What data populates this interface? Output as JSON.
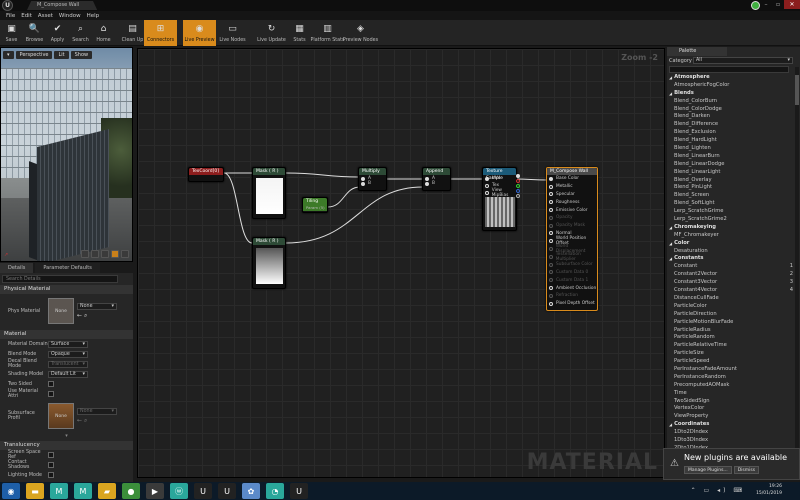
{
  "window": {
    "title": "M_Compose Wall",
    "tab_label": "M_Compose Wall",
    "logo": "U"
  },
  "menu": [
    "File",
    "Edit",
    "Asset",
    "Window",
    "Help"
  ],
  "toolbar": [
    {
      "id": "save",
      "label": "Save",
      "icon": "save-icon",
      "glyph": "▣"
    },
    {
      "id": "browse",
      "label": "Browse",
      "icon": "browse-icon",
      "glyph": "🔍"
    },
    {
      "id": "apply",
      "label": "Apply",
      "icon": "apply-icon",
      "glyph": "✔"
    },
    {
      "id": "search",
      "label": "Search",
      "icon": "search-icon",
      "glyph": "⌕"
    },
    {
      "id": "home",
      "label": "Home",
      "icon": "home-icon",
      "glyph": "⌂"
    },
    {
      "id": "cleanup",
      "label": "Clean Up",
      "icon": "cleanup-icon",
      "glyph": "▤"
    },
    {
      "id": "connectors",
      "label": "Connectors",
      "icon": "connectors-icon",
      "glyph": "⊞",
      "active": true
    },
    {
      "id": "livepreview",
      "label": "Live Preview",
      "icon": "live-preview-icon",
      "glyph": "◉",
      "active": true
    },
    {
      "id": "livenodes",
      "label": "Live Nodes",
      "icon": "live-nodes-icon",
      "glyph": "▭"
    },
    {
      "id": "liveupdate",
      "label": "Live Update",
      "icon": "live-update-icon",
      "glyph": "↻"
    },
    {
      "id": "stats",
      "label": "Stats",
      "icon": "stats-icon",
      "glyph": "▦"
    },
    {
      "id": "platformstats",
      "label": "Platform Stats",
      "icon": "platform-stats-icon",
      "glyph": "▥"
    },
    {
      "id": "previewnodes",
      "label": "Preview Nodes",
      "icon": "preview-nodes-icon",
      "glyph": "◈"
    }
  ],
  "viewport": {
    "perspective": "Perspective",
    "lit": "Lit",
    "show": "Show"
  },
  "details": {
    "tabs": [
      "Details",
      "Parameter Defaults"
    ],
    "search_placeholder": "Search Details",
    "sections": {
      "physical": "Physical Material",
      "material": "Material",
      "translucency": "Translucency"
    },
    "phys_material_label": "Phys Material",
    "phys_material_value": "None",
    "thumb_none": "None",
    "rows": [
      {
        "k": "Material Domain",
        "v": "Surface"
      },
      {
        "k": "Blend Mode",
        "v": "Opaque"
      },
      {
        "k": "Decal Blend Mode",
        "v": "Translucent",
        "disabled": true
      },
      {
        "k": "Shading Model",
        "v": "Default Lit"
      }
    ],
    "checks": [
      "Two Sided",
      "Use Material Attri"
    ],
    "subsurface_label": "Subsurface Profil",
    "subsurface_value": "None",
    "trans_rows": [
      "Screen Space Ref",
      "Contact Shadows",
      "Lighting Mode"
    ]
  },
  "graph": {
    "zoom": "Zoom -2",
    "watermark": "MATERIAL",
    "nodes": {
      "texcoord": {
        "title": "TexCoord[0]"
      },
      "mask1": {
        "title": "Mask ( R )"
      },
      "mask2": {
        "title": "Mask ( R )"
      },
      "tiling": {
        "title": "Tiling",
        "sub": "Param (5)"
      },
      "multiply": {
        "title": "Multiply",
        "pins": [
          "A",
          "B"
        ]
      },
      "append": {
        "title": "Append",
        "pins": [
          "A",
          "B"
        ]
      },
      "texsample": {
        "title": "Texture Sample",
        "pins": [
          "UVs",
          "Tex",
          "View MipBias"
        ]
      },
      "result": {
        "title": "M_Compose Wall",
        "pins": [
          {
            "l": "Base Color",
            "on": true
          },
          {
            "l": "Metallic"
          },
          {
            "l": "Specular"
          },
          {
            "l": "Roughness"
          },
          {
            "l": "Emissive Color"
          },
          {
            "l": "Opacity",
            "dim": true
          },
          {
            "l": "Opacity Mask",
            "dim": true
          },
          {
            "l": "Normal"
          },
          {
            "l": "World Position Offset"
          },
          {
            "l": "World Displacement",
            "dim": true
          },
          {
            "l": "Tessellation Multiplier",
            "dim": true
          },
          {
            "l": "Subsurface Color",
            "dim": true
          },
          {
            "l": "Custom Data 0",
            "dim": true
          },
          {
            "l": "Custom Data 1",
            "dim": true
          },
          {
            "l": "Ambient Occlusion"
          },
          {
            "l": "Refraction",
            "dim": true
          },
          {
            "l": "Pixel Depth Offset"
          }
        ]
      }
    }
  },
  "palette": {
    "tab": "Palette",
    "category_label": "Category",
    "category_value": "All",
    "items": [
      {
        "l": "Atmosphere",
        "cat": true
      },
      {
        "l": "AtmosphericFogColor"
      },
      {
        "l": "Blends",
        "cat": true
      },
      {
        "l": "Blend_ColorBurn"
      },
      {
        "l": "Blend_ColorDodge"
      },
      {
        "l": "Blend_Darken"
      },
      {
        "l": "Blend_Difference"
      },
      {
        "l": "Blend_Exclusion"
      },
      {
        "l": "Blend_HardLight"
      },
      {
        "l": "Blend_Lighten"
      },
      {
        "l": "Blend_LinearBurn"
      },
      {
        "l": "Blend_LinearDodge"
      },
      {
        "l": "Blend_LinearLight"
      },
      {
        "l": "Blend_Overlay"
      },
      {
        "l": "Blend_PinLight"
      },
      {
        "l": "Blend_Screen"
      },
      {
        "l": "Blend_SoftLight"
      },
      {
        "l": "Lerp_ScratchGrime"
      },
      {
        "l": "Lerp_ScratchGrime2"
      },
      {
        "l": "Chromakeying",
        "cat": true
      },
      {
        "l": "MF_Chromakeyer"
      },
      {
        "l": "Color",
        "cat": true
      },
      {
        "l": "Desaturation"
      },
      {
        "l": "Constants",
        "cat": true
      },
      {
        "l": "Constant",
        "k": "1"
      },
      {
        "l": "Constant2Vector",
        "k": "2"
      },
      {
        "l": "Constant3Vector",
        "k": "3"
      },
      {
        "l": "Constant4Vector",
        "k": "4"
      },
      {
        "l": "DistanceCullFade"
      },
      {
        "l": "ParticleColor"
      },
      {
        "l": "ParticleDirection"
      },
      {
        "l": "ParticleMotionBlurFade"
      },
      {
        "l": "ParticleRadius"
      },
      {
        "l": "ParticleRandom"
      },
      {
        "l": "ParticleRelativeTime"
      },
      {
        "l": "ParticleSize"
      },
      {
        "l": "ParticleSpeed"
      },
      {
        "l": "PerInstanceFadeAmount"
      },
      {
        "l": "PerInstanceRandom"
      },
      {
        "l": "PrecomputedAOMask"
      },
      {
        "l": "Time"
      },
      {
        "l": "TwoSidedSign"
      },
      {
        "l": "VertexColor"
      },
      {
        "l": "ViewProperty"
      },
      {
        "l": "Coordinates",
        "cat": true
      },
      {
        "l": "1Dto2DIndex"
      },
      {
        "l": "1Dto3DIndex"
      },
      {
        "l": "2Dto1DIndex"
      }
    ]
  },
  "notification": {
    "message": "New plugins are available",
    "manage": "Manage Plugins...",
    "dismiss": "Dismiss"
  },
  "taskbar": {
    "apps": [
      {
        "n": "start-icon",
        "g": "◉",
        "c": "#1e5fa8"
      },
      {
        "n": "explorer-icon",
        "g": "▬",
        "c": "#d9a520"
      },
      {
        "n": "app-m-icon",
        "g": "M",
        "c": "#2aa79b"
      },
      {
        "n": "app-m2-icon",
        "g": "M",
        "c": "#2aa79b"
      },
      {
        "n": "folder-icon",
        "g": "▰",
        "c": "#d9a520"
      },
      {
        "n": "chrome-icon",
        "g": "●",
        "c": "#3b8f3b"
      },
      {
        "n": "video-icon",
        "g": "▶",
        "c": "#3a3a3a"
      },
      {
        "n": "app-w-icon",
        "g": "ⓦ",
        "c": "#2aa79b"
      },
      {
        "n": "unreal-icon",
        "g": "U",
        "c": "#222"
      },
      {
        "n": "unreal2-icon",
        "g": "U",
        "c": "#222"
      },
      {
        "n": "paint-icon",
        "g": "✿",
        "c": "#5b8ac9"
      },
      {
        "n": "app-circle-icon",
        "g": "◔",
        "c": "#2aa79b"
      },
      {
        "n": "unreal3-icon",
        "g": "U",
        "c": "#222"
      }
    ],
    "time": "19:26",
    "date": "15/01/2019"
  }
}
